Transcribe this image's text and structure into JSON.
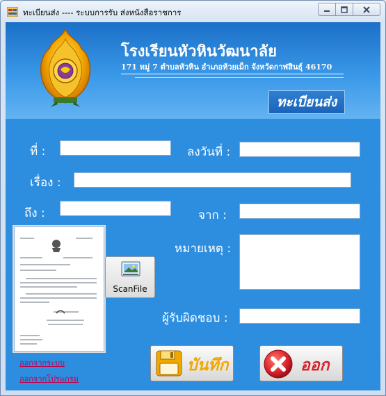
{
  "window": {
    "title": "ทะเบียนส่ง ---- ระบบการรับ ส่งหนังสือราชการ"
  },
  "header": {
    "school_name": "โรงเรียนหัวหินวัฒนาลัย",
    "address": "171 หมู่ 7   ตำบลหัวหิน  อำเภอห้วยเม็ก  จังหวัดกาฬสินธุ์ 46170",
    "section_title": "ทะเบียนส่ง"
  },
  "form": {
    "number_label": "ที่  :",
    "date_label": "ลงวันที่  :",
    "subject_label": "เรื่อง  :",
    "to_label": "ถึง  :",
    "from_label": "จาก  :",
    "note_label": "หมายเหตุ  :",
    "responsible_label": "ผู้รับผิดชอบ  :",
    "number_value": "",
    "date_value": "",
    "subject_value": "",
    "to_value": "",
    "from_value": "",
    "note_value": "",
    "responsible_value": ""
  },
  "buttons": {
    "scan_label": "ScanFile",
    "save_label": "บันทึก",
    "exit_label": "ออก"
  },
  "links": {
    "logout": "ออกจากระบบ",
    "exit_program": "ออกจากโปรแกรม"
  },
  "colors": {
    "client_bg": "#2d8ee0",
    "save_accent": "#f0a800",
    "exit_accent": "#d8202a",
    "link": "#c0004f"
  },
  "icons": {
    "app": "form-icon",
    "logo": "school-emblem",
    "scan": "scanner-image-icon",
    "save": "floppy-disk-icon",
    "exit": "close-x-icon"
  }
}
